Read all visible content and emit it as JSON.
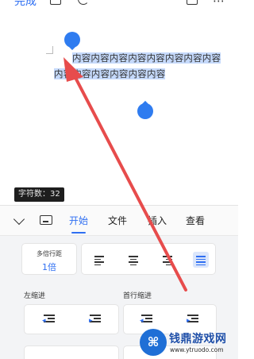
{
  "topbar": {
    "done_label": "完成"
  },
  "document": {
    "line1": "内容内容内容内容内容内容内容内容",
    "line2": "内容内容内容内容内容内容"
  },
  "word_count": "字符数：32",
  "toolbar": {
    "tabs": [
      {
        "label": "开始",
        "active": true
      },
      {
        "label": "文件",
        "active": false
      },
      {
        "label": "插入",
        "active": false
      },
      {
        "label": "查看",
        "active": false
      }
    ],
    "line_spacing": {
      "title": "多倍行距",
      "value": "1倍"
    },
    "alignments": [
      "align-left",
      "align-center",
      "align-right",
      "align-justify"
    ],
    "active_alignment": "align-justify",
    "left_indent_label": "左缩进",
    "first_line_indent_label": "首行缩进"
  },
  "watermark": {
    "brand": "钱鼎游戏网",
    "url": "www.ytruodo.com"
  },
  "colors": {
    "accent": "#2f6ff2",
    "selection": "#c5d9fb",
    "arrow": "#e74c4c"
  }
}
